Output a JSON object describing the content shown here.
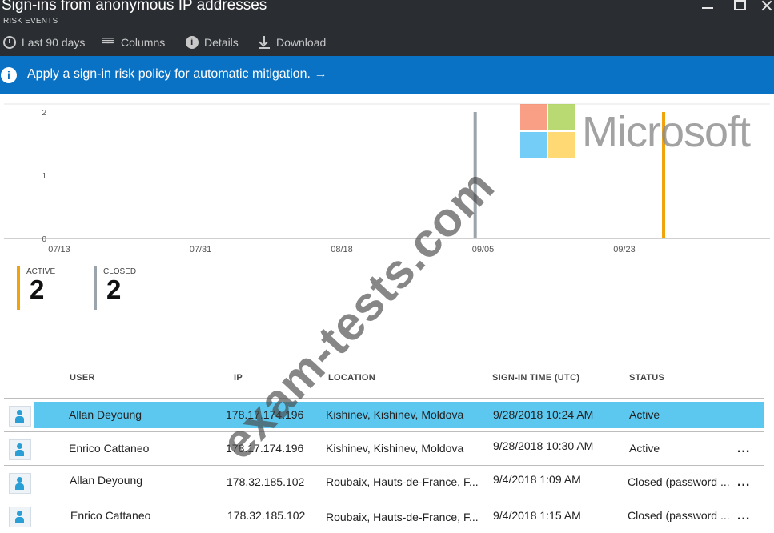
{
  "window": {
    "title": "Sign-ins from anonymous IP addresses",
    "subtitle": "RISK EVENTS"
  },
  "toolbar": {
    "items": [
      {
        "label": "Last 90 days",
        "icon": "clock-icon"
      },
      {
        "label": "Columns",
        "icon": "columns-icon"
      },
      {
        "label": "Details",
        "icon": "info-icon"
      },
      {
        "label": "Download",
        "icon": "download-icon"
      }
    ]
  },
  "banner": {
    "text": "Apply a sign-in risk policy for automatic mitigation. →"
  },
  "chart_data": {
    "type": "bar",
    "x_ticks": [
      "07/13",
      "07/31",
      "08/18",
      "09/05",
      "09/23"
    ],
    "y_ticks": [
      "0",
      "1",
      "2"
    ],
    "ylim": [
      0,
      2
    ],
    "series": [
      {
        "name": "CLOSED",
        "color": "#9ba3ab",
        "x": [
          "09/04"
        ],
        "values": [
          2
        ]
      },
      {
        "name": "ACTIVE",
        "color": "#f0a30a",
        "x": [
          "09/28"
        ],
        "values": [
          2
        ]
      }
    ]
  },
  "counters": [
    {
      "label": "ACTIVE",
      "value": "2",
      "color": "#f0a30a"
    },
    {
      "label": "CLOSED",
      "value": "2",
      "color": "#9ba3ab"
    }
  ],
  "table": {
    "headers": [
      "USER",
      "IP",
      "LOCATION",
      "SIGN-IN TIME (UTC)",
      "STATUS"
    ],
    "rows": [
      {
        "user": "Allan Deyoung",
        "ip": "178.17.174.196",
        "location": "Kishinev, Kishinev, Moldova",
        "time": "9/28/2018 10:24 AM",
        "status": "Active",
        "more": ""
      },
      {
        "user": "Enrico Cattaneo",
        "ip": "178.17.174.196",
        "location": "Kishinev, Kishinev, Moldova",
        "time": "9/28/2018 10:30 AM",
        "status": "Active",
        "more": "..."
      },
      {
        "user": "Allan Deyoung",
        "ip": "178.32.185.102",
        "location": "Roubaix, Hauts-de-France, F...",
        "time": "9/4/2018 1:09 AM",
        "status": "Closed (password ...",
        "more": "..."
      },
      {
        "user": "Enrico Cattaneo",
        "ip": "178.32.185.102",
        "location": "Roubaix, Hauts-de-France, F...",
        "time": "9/4/2018 1:15 AM",
        "status": "Closed (password ...",
        "more": "..."
      }
    ]
  },
  "watermark": {
    "brand": "Microsoft",
    "diagonal": "exam-tests.com",
    "logo_colors": [
      "#f25022",
      "#7fba00",
      "#00a4ef",
      "#ffb900"
    ]
  }
}
